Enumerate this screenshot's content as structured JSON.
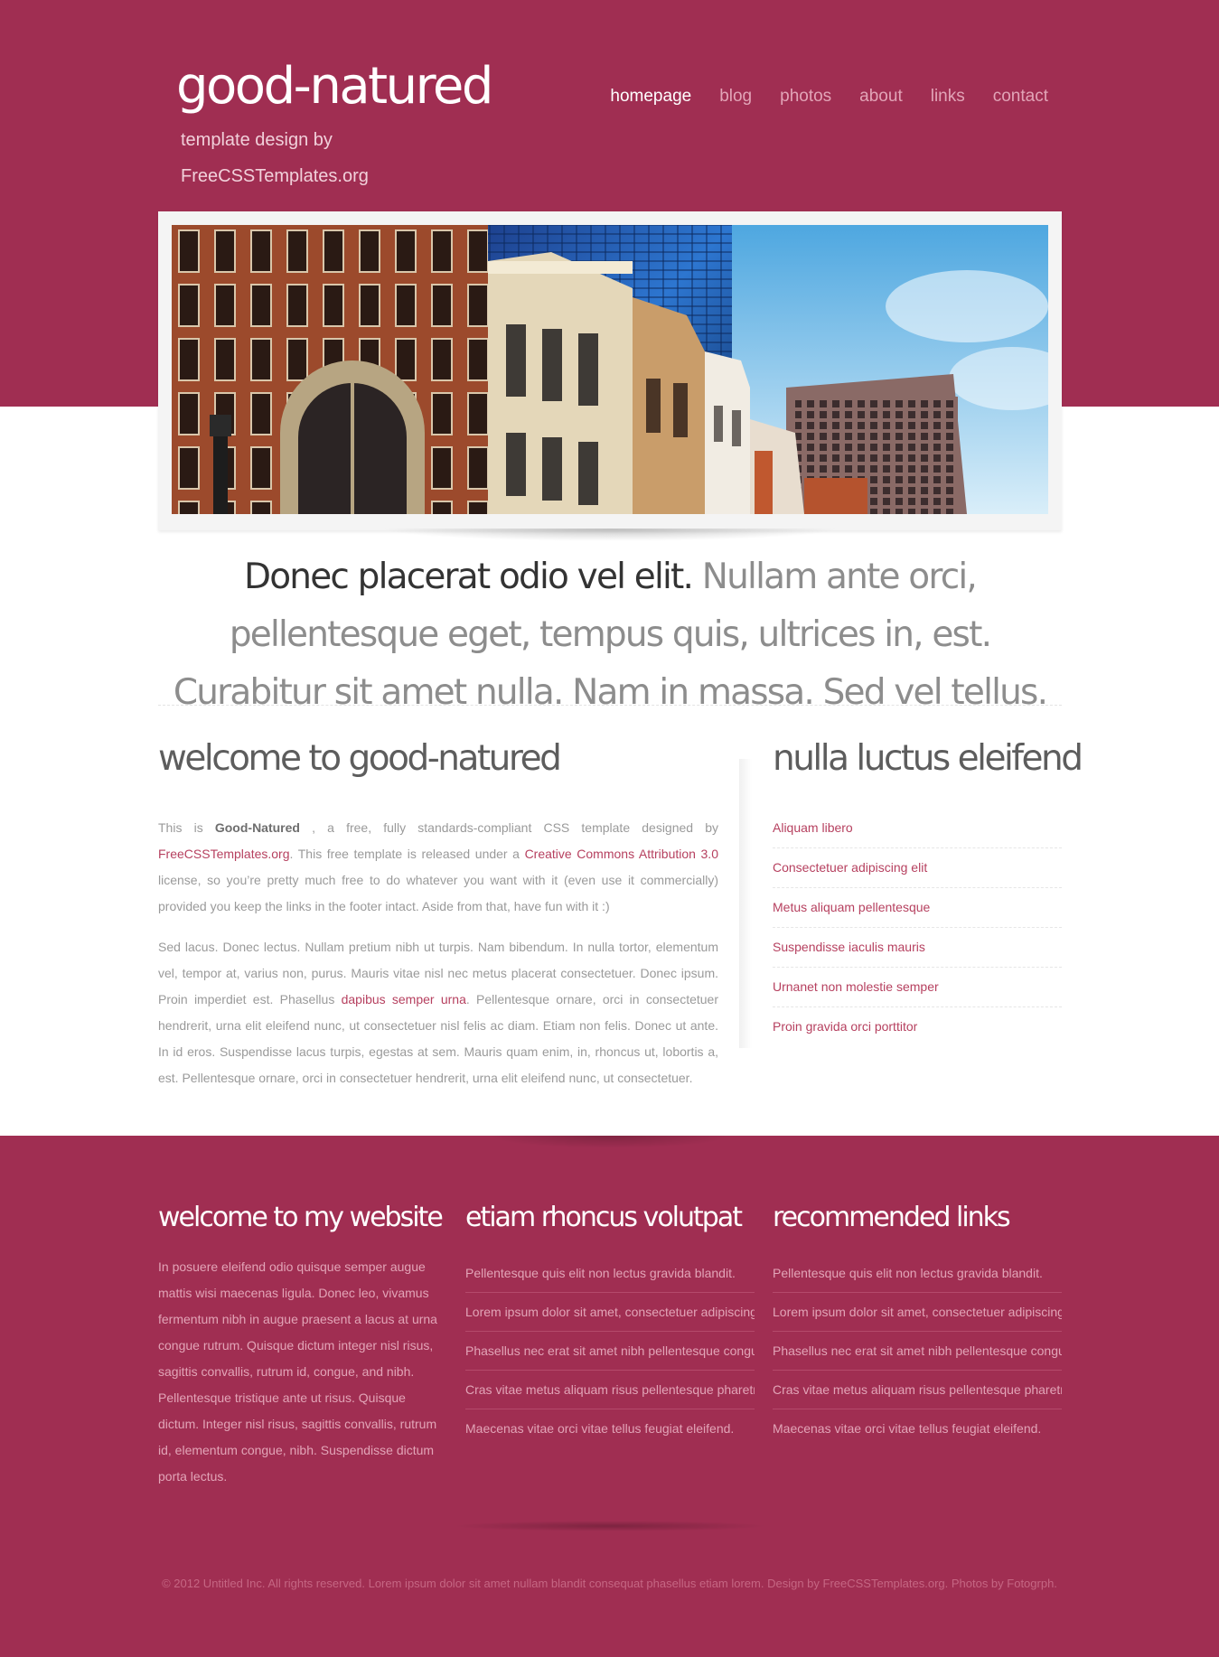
{
  "header": {
    "logo": "good-natured",
    "tagline_line1": "template design by",
    "tagline_line2": "FreeCSSTemplates.org"
  },
  "nav": {
    "items": [
      "homepage",
      "blog",
      "photos",
      "about",
      "links",
      "contact"
    ],
    "active": "homepage"
  },
  "banner": {
    "image": "city-buildings-photo"
  },
  "intro": {
    "lead": "Donec placerat odio vel elit.",
    "rest": " Nullam ante orci, pellentesque eget, tempus quis, ultrices in, est. Curabitur sit amet nulla. Nam in massa. Sed vel tellus."
  },
  "main": {
    "title": "welcome to good-natured",
    "p1": {
      "t1": "This is ",
      "bold": "Good-Natured",
      "t2": " , a free, fully standards-compliant CSS template designed by ",
      "link1": "FreeCSSTemplates.org",
      "t3": ". This free template is released under a ",
      "link2": "Creative Commons Attribution 3.0",
      "t4": " license, so you’re pretty much free to do whatever you want with it (even use it commercially) provided you keep the links in the footer intact. Aside from that, have fun with it :)"
    },
    "p2": {
      "t1": "Sed lacus. Donec lectus. Nullam pretium nibh ut turpis. Nam bibendum. In nulla tortor, elementum vel, tempor at, varius non, purus. Mauris vitae nisl nec metus placerat consectetuer. Donec ipsum. Proin imperdiet est. Phasellus ",
      "link": "dapibus semper urna",
      "t2": ". Pellentesque ornare, orci in consectetuer hendrerit, urna elit eleifend nunc, ut consectetuer nisl felis ac diam. Etiam non felis. Donec ut ante. In id eros. Suspendisse lacus turpis, egestas at sem. Mauris quam enim, in, rhoncus ut, lobortis a, est. Pellentesque ornare, orci in consectetuer hendrerit, urna elit eleifend nunc, ut consectetuer."
    }
  },
  "sidebar": {
    "title": "nulla luctus eleifend",
    "links": [
      "Aliquam libero",
      "Consectetuer adipiscing elit",
      "Metus aliquam pellentesque",
      "Suspendisse iaculis mauris",
      "Urnanet non molestie semper",
      "Proin gravida orci porttitor"
    ]
  },
  "footer": {
    "col1": {
      "title": "welcome to my website",
      "text": "In posuere eleifend odio quisque semper augue mattis wisi maecenas ligula. Donec leo, vivamus fermentum nibh in augue praesent a lacus at urna congue rutrum. Quisque dictum integer nisl risus, sagittis convallis, rutrum id, congue, and nibh. Pellentesque tristique ante ut risus. Quisque dictum. Integer nisl risus, sagittis convallis, rutrum id, elementum congue, nibh. Suspendisse dictum porta lectus."
    },
    "col2": {
      "title": "etiam rhoncus volutpat",
      "items": [
        "Pellentesque quis elit non lectus gravida blandit.",
        "Lorem ipsum dolor sit amet, consectetuer adipiscing elit.",
        "Phasellus nec erat sit amet nibh pellentesque congue.",
        "Cras vitae metus aliquam risus pellentesque pharetra.",
        "Maecenas vitae orci vitae tellus feugiat eleifend."
      ]
    },
    "col3": {
      "title": "recommended links",
      "items": [
        "Pellentesque quis elit non lectus gravida blandit.",
        "Lorem ipsum dolor sit amet, consectetuer adipiscing elit.",
        "Phasellus nec erat sit amet nibh pellentesque congue.",
        "Cras vitae metus aliquam risus pellentesque pharetra.",
        "Maecenas vitae orci vitae tellus feugiat eleifend."
      ]
    },
    "copyright": "© 2012 Untitled Inc. All rights reserved. Lorem ipsum dolor sit amet nullam blandit consequat phasellus etiam lorem. Design by FreeCSSTemplates.org. Photos by Fotogrph."
  },
  "colors": {
    "brand": "#a02e52",
    "link": "#b6405f",
    "heading": "#5d5d5d"
  }
}
